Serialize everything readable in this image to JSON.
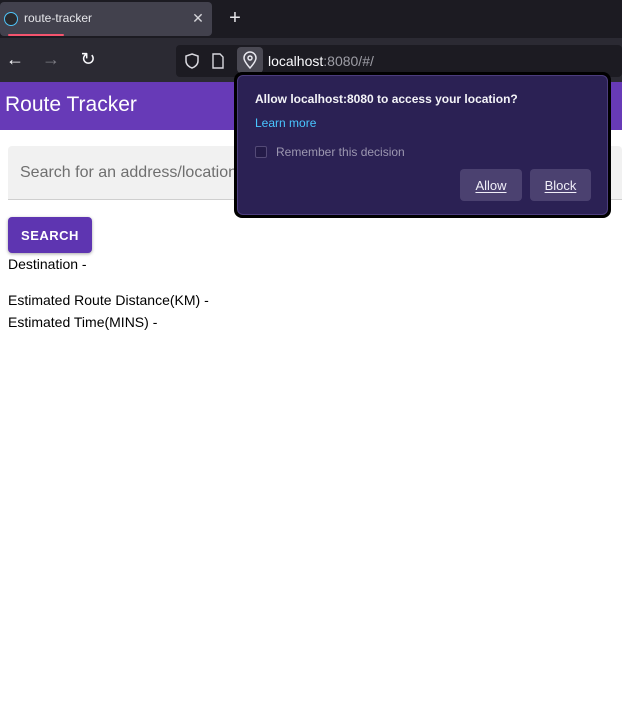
{
  "browser": {
    "tab": {
      "title": "route-tracker",
      "close_glyph": "✕",
      "icon": "globe-icon"
    },
    "new_tab_glyph": "+",
    "nav": {
      "back_glyph": "←",
      "forward_glyph": "→",
      "reload_glyph": "↻"
    },
    "url": {
      "host": "localhost",
      "rest": ":8080/#/"
    }
  },
  "app": {
    "title": "Route Tracker",
    "header_color": "#673ab7",
    "search": {
      "placeholder": "Search for an address/location",
      "value": "",
      "button_label": "SEARCH",
      "button_color": "#5e35b1"
    },
    "info": {
      "destination": "Destination -",
      "distance": "Estimated Route Distance(KM) -",
      "time": "Estimated Time(MINS) -"
    }
  },
  "permission_popup": {
    "heading": "Allow localhost:8080 to access your location?",
    "learn_more": "Learn more",
    "remember": "Remember this decision",
    "remember_checked": false,
    "allow_label": "Allow",
    "block_label": "Block",
    "accent_color": "#2b2154",
    "link_color": "#49c6ff"
  }
}
